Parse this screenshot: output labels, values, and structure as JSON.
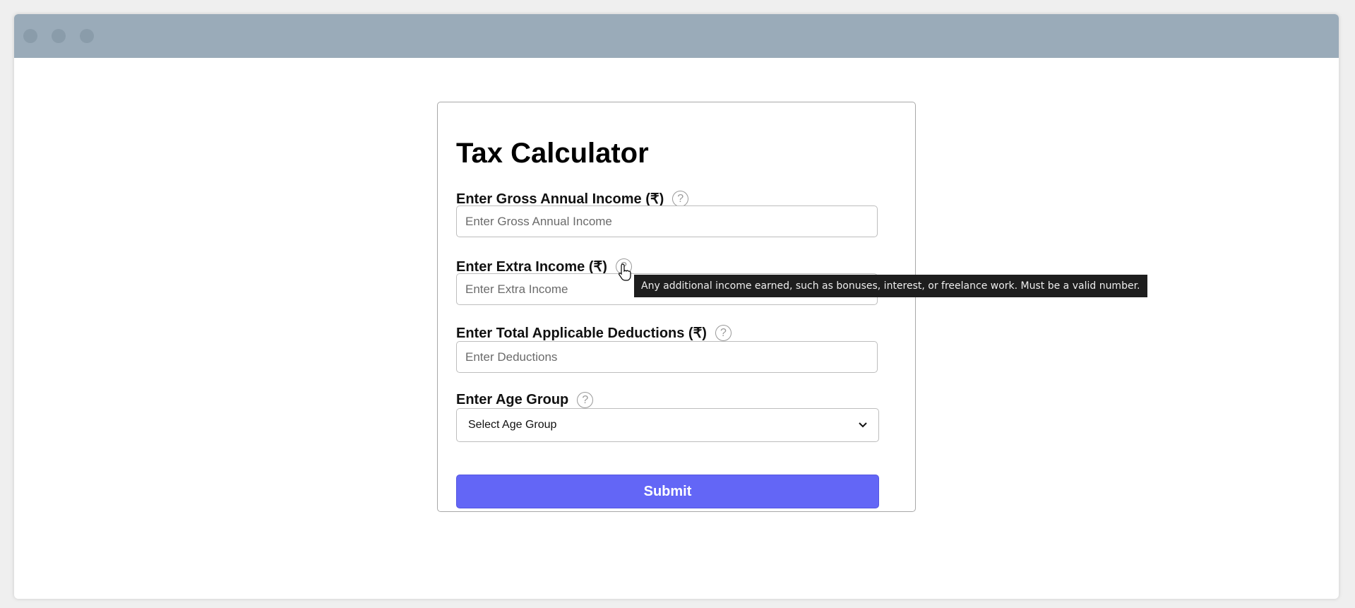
{
  "form": {
    "title": "Tax Calculator",
    "fields": [
      {
        "label": "Enter Gross Annual Income (₹)",
        "placeholder": "Enter Gross Annual Income",
        "value": ""
      },
      {
        "label": "Enter Extra Income (₹)",
        "placeholder": "Enter Extra Income",
        "value": ""
      },
      {
        "label": "Enter Total Applicable Deductions (₹)",
        "placeholder": "Enter Deductions",
        "value": ""
      }
    ],
    "age_group": {
      "label": "Enter Age Group",
      "selected": "Select Age Group"
    },
    "help_icon": "?",
    "submit_label": "Submit"
  },
  "tooltip": {
    "text": "Any additional income earned, such as bonuses, interest, or freelance work. Must be a valid number."
  },
  "colors": {
    "accent": "#6366f6",
    "titlebar": "#9aabb9"
  }
}
